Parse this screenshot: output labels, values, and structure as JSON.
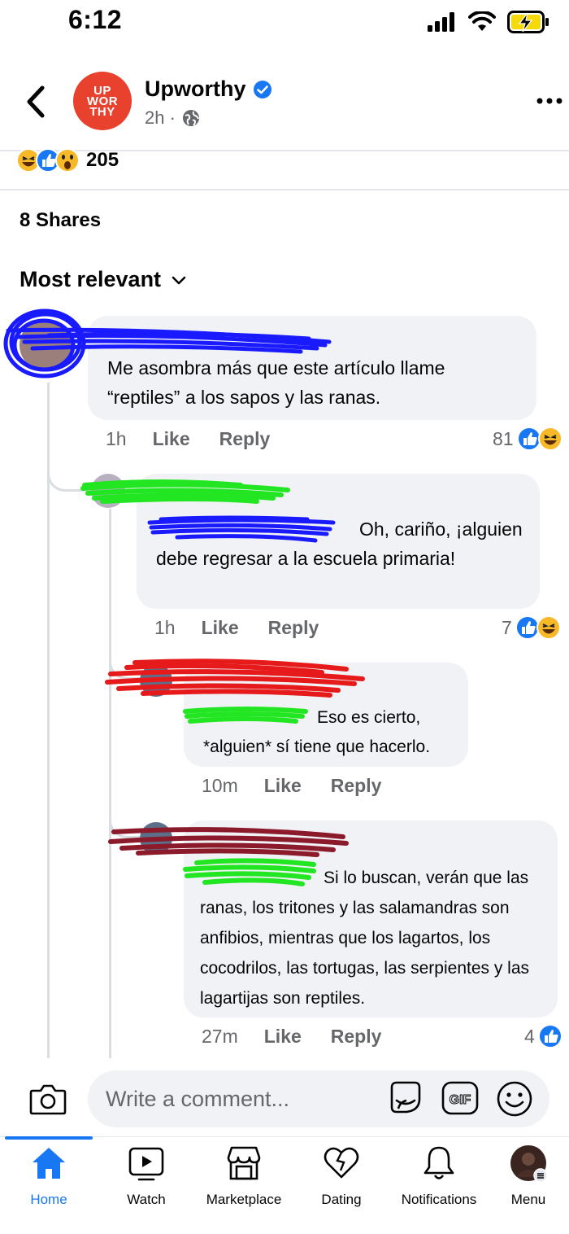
{
  "status_bar": {
    "time": "6:12"
  },
  "header": {
    "logo_text": [
      "UP",
      "WOR",
      "THY"
    ],
    "page_name": "Upworthy",
    "post_age": "2h ·"
  },
  "reactions": {
    "count": "205"
  },
  "shares": "8 Shares",
  "sort_label": "Most relevant",
  "comments": [
    {
      "text": "Me asombra más que este artículo llame “reptiles” a los sapos y las ranas.",
      "time": "1h",
      "like": "Like",
      "reply": "Reply",
      "reaction_count": "81"
    },
    {
      "text": "Oh, cariño, ¡alguien debe regresar a la escuela primaria!",
      "time": "1h",
      "like": "Like",
      "reply": "Reply",
      "reaction_count": "7"
    },
    {
      "text": "Eso es cierto, *alguien* sí tiene que hacerlo.",
      "time": "10m",
      "like": "Like",
      "reply": "Reply"
    },
    {
      "text": "Si lo buscan, verán que las ranas, los tritones y las salamandras son anfibios, mientras que los lagartos, los cocodrilos, las tortugas, las serpientes y las lagartijas son reptiles.",
      "time": "27m",
      "like": "Like",
      "reply": "Reply",
      "reaction_count": "4"
    }
  ],
  "composer": {
    "placeholder": "Write a comment..."
  },
  "nav": [
    {
      "label": "Home",
      "active": true
    },
    {
      "label": "Watch"
    },
    {
      "label": "Marketplace"
    },
    {
      "label": "Dating"
    },
    {
      "label": "Notifications"
    },
    {
      "label": "Menu"
    }
  ],
  "colors": {
    "accent": "#1877f2",
    "logo_red": "#e8412d",
    "bubble": "#f0f2f5",
    "muted_text": "#65676b",
    "scribble_blue": "#1a1aff",
    "scribble_green": "#22e622",
    "scribble_red": "#e61a1a",
    "scribble_maroon": "#8b1a2a"
  }
}
